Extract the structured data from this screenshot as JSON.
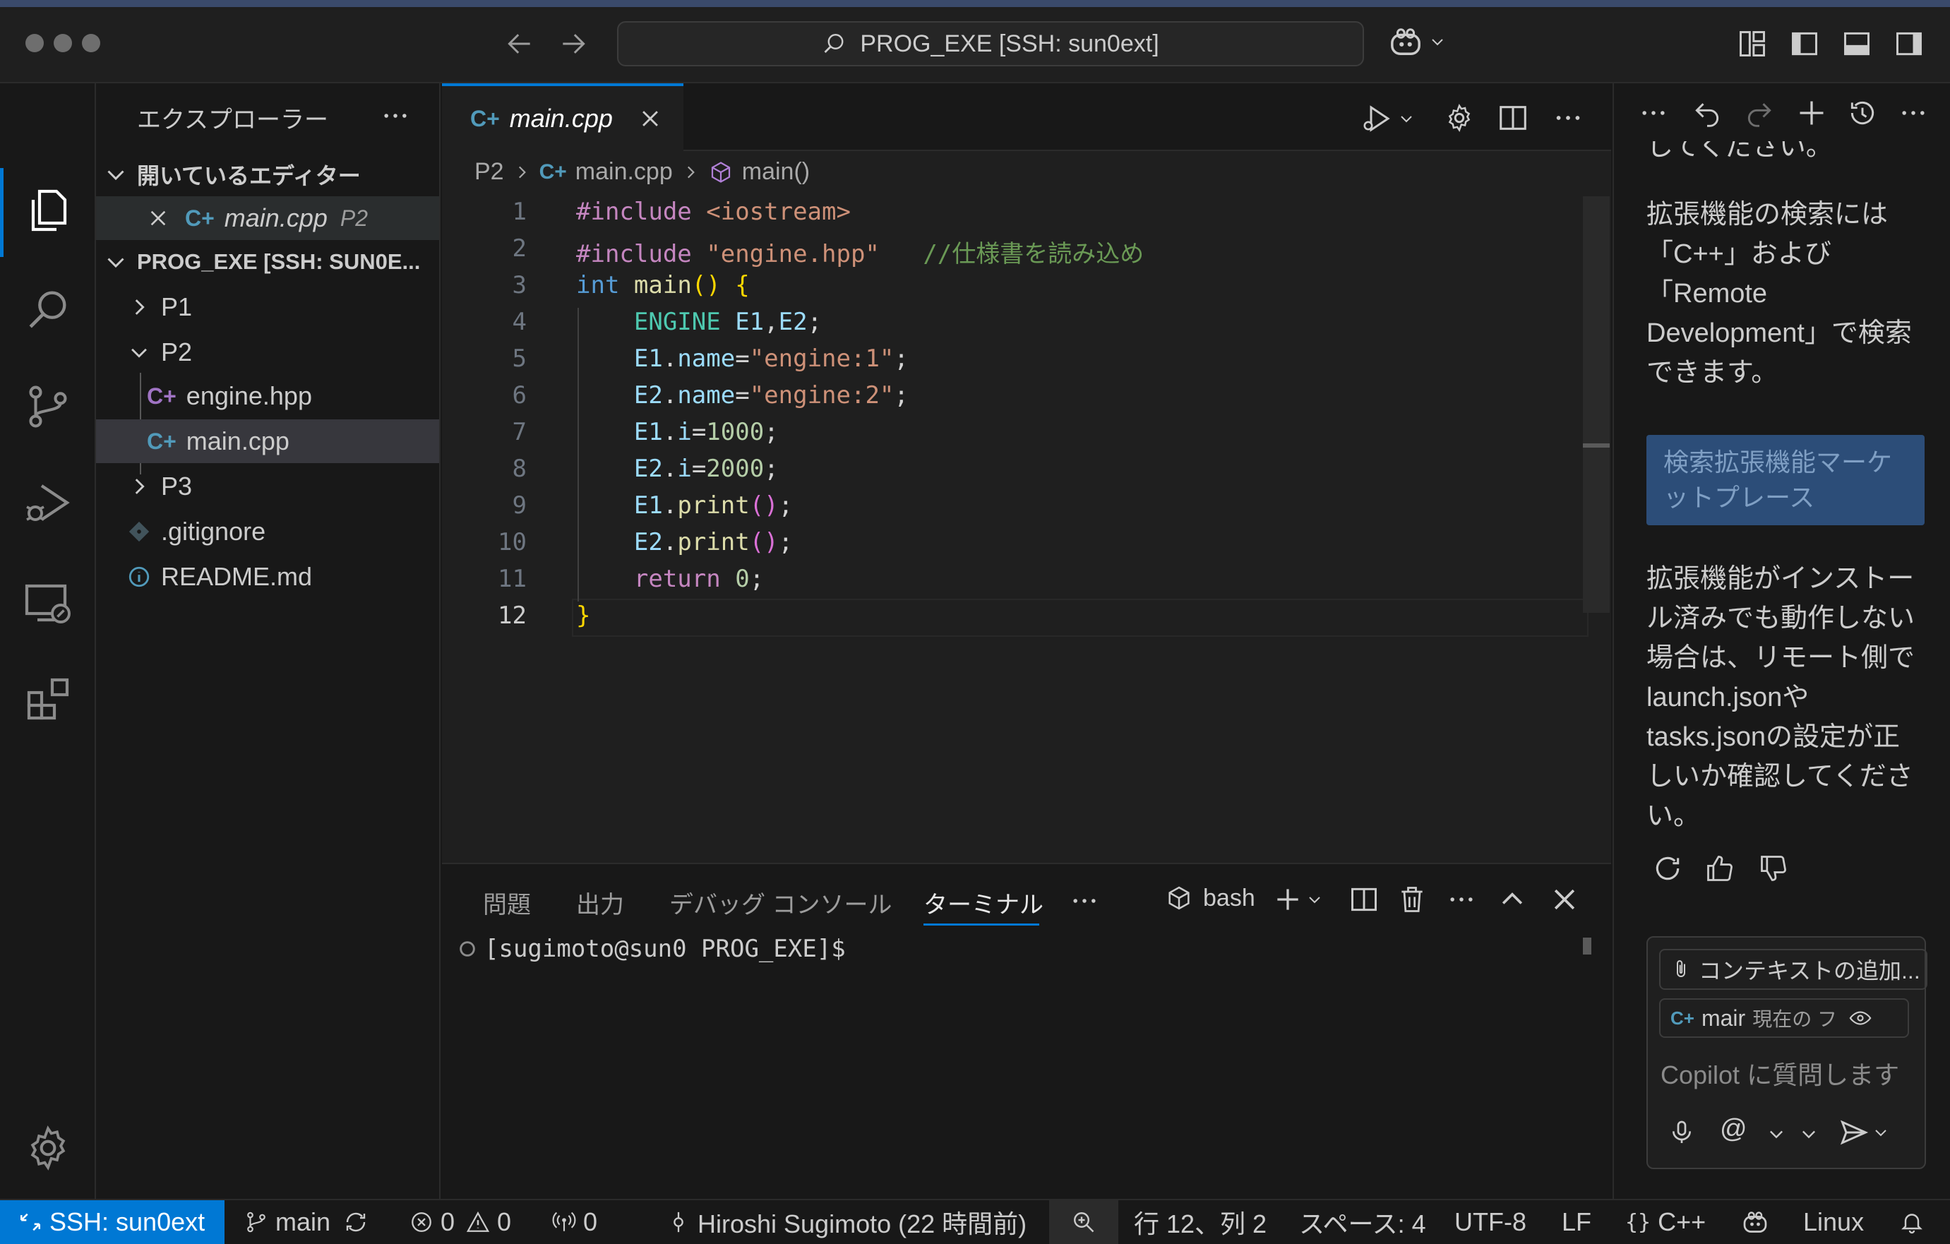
{
  "titlebar": {
    "command_center": "PROG_EXE [SSH: sun0ext]"
  },
  "sidebar": {
    "title": "エクスプローラー",
    "open_editors_header": "開いているエディター",
    "open_editor": {
      "name": "main.cpp",
      "folder": "P2"
    },
    "workspace_header": "PROG_EXE [SSH: SUN0E...",
    "tree": [
      {
        "label": "P1",
        "type": "folder"
      },
      {
        "label": "P2",
        "type": "folder-open"
      },
      {
        "label": "engine.hpp",
        "type": "cpp"
      },
      {
        "label": "main.cpp",
        "type": "cpp"
      },
      {
        "label": "P3",
        "type": "folder"
      },
      {
        "label": ".gitignore",
        "type": "git"
      },
      {
        "label": "README.md",
        "type": "info"
      }
    ]
  },
  "editor": {
    "tab": "main.cpp",
    "breadcrumb": {
      "folder": "P2",
      "file": "main.cpp",
      "symbol": "main()"
    },
    "line_numbers": [
      "1",
      "2",
      "3",
      "4",
      "5",
      "6",
      "7",
      "8",
      "9",
      "10",
      "11",
      "12"
    ],
    "lines": [
      "#include <iostream>",
      "#include \"engine.hpp\"   //仕様書を読み込め",
      "int main() {",
      "    ENGINE E1,E2;",
      "    E1.name=\"engine:1\";",
      "    E2.name=\"engine:2\";",
      "    E1.i=1000;",
      "    E2.i=2000;",
      "    E1.print();",
      "    E2.print();",
      "    return 0;",
      "}"
    ]
  },
  "panel": {
    "tabs": [
      "問題",
      "出力",
      "デバッグ コンソール",
      "ターミナル"
    ],
    "active_tab": "ターミナル",
    "shell": "bash",
    "prompt": "[sugimoto@sun0 PROG_EXE]$"
  },
  "chat": {
    "partial_top": "してください。",
    "paragraph1": [
      "拡張機能の検索には",
      "「C++」および",
      "「Remote",
      "Development」で検索",
      "できます。"
    ],
    "button": [
      "検索拡張機能マーケ",
      "ットプレース"
    ],
    "paragraph2": [
      "拡張機能がインストー",
      "ル済みでも動作しない",
      "場合は、リモート側で",
      "launch.jsonや",
      "tasks.jsonの設定が正",
      "しいか確認してくださ",
      "い。"
    ],
    "add_context": "コンテキストの追加...",
    "file_chip": "mair",
    "file_chip_hint": "現在の フ",
    "placeholder": "Copilot に質問します"
  },
  "statusbar": {
    "remote": "SSH: sun0ext",
    "branch": "main",
    "errors": "0",
    "warnings": "0",
    "ports": "0",
    "blame": "Hiroshi Sugimoto (22 時間前)",
    "position": "行 12、列 2",
    "spaces": "スペース: 4",
    "encoding": "UTF-8",
    "eol": "LF",
    "language": "C++",
    "os": "Linux"
  },
  "colors": {
    "accent": "#0078d4",
    "remote_bg": "#0078d4",
    "chat_button": "#2c4d78"
  }
}
